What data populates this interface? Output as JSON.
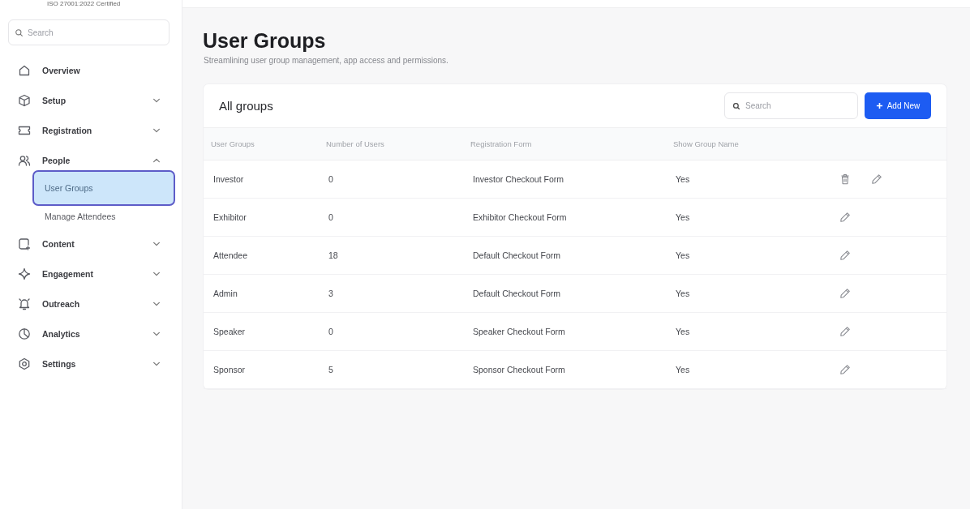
{
  "sidebar": {
    "certification": "ISO 27001:2022 Certified",
    "search": {
      "placeholder": "Search"
    },
    "items": [
      {
        "label": "Overview",
        "kind": "link"
      },
      {
        "label": "Setup",
        "kind": "group",
        "expanded": false
      },
      {
        "label": "Registration",
        "kind": "group",
        "expanded": false
      },
      {
        "label": "People",
        "kind": "group",
        "expanded": true,
        "children": [
          {
            "label": "User Groups",
            "selected": true
          },
          {
            "label": "Manage Attendees",
            "selected": false
          }
        ]
      },
      {
        "label": "Content",
        "kind": "group",
        "expanded": false
      },
      {
        "label": "Engagement",
        "kind": "group",
        "expanded": false
      },
      {
        "label": "Outreach",
        "kind": "group",
        "expanded": false
      },
      {
        "label": "Analytics",
        "kind": "group",
        "expanded": false
      },
      {
        "label": "Settings",
        "kind": "group",
        "expanded": false
      }
    ]
  },
  "page": {
    "title": "User Groups",
    "subtitle": "Streamlining user group management, app access and permissions."
  },
  "table": {
    "title": "All groups",
    "search": {
      "placeholder": "Search"
    },
    "add_button": {
      "label": "Add New"
    },
    "columns": [
      "User Groups",
      "Number of Users",
      "Registration Form",
      "Show Group Name"
    ],
    "rows": [
      {
        "group": "Investor",
        "users": "0",
        "form": "Investor Checkout Form",
        "show_name": "Yes",
        "deletable": true
      },
      {
        "group": "Exhibitor",
        "users": "0",
        "form": "Exhibitor Checkout Form",
        "show_name": "Yes",
        "deletable": false
      },
      {
        "group": "Attendee",
        "users": "18",
        "form": "Default Checkout Form",
        "show_name": "Yes",
        "deletable": false
      },
      {
        "group": "Admin",
        "users": "3",
        "form": "Default Checkout Form",
        "show_name": "Yes",
        "deletable": false
      },
      {
        "group": "Speaker",
        "users": "0",
        "form": "Speaker Checkout Form",
        "show_name": "Yes",
        "deletable": false
      },
      {
        "group": "Sponsor",
        "users": "5",
        "form": "Sponsor Checkout Form",
        "show_name": "Yes",
        "deletable": false
      }
    ]
  }
}
